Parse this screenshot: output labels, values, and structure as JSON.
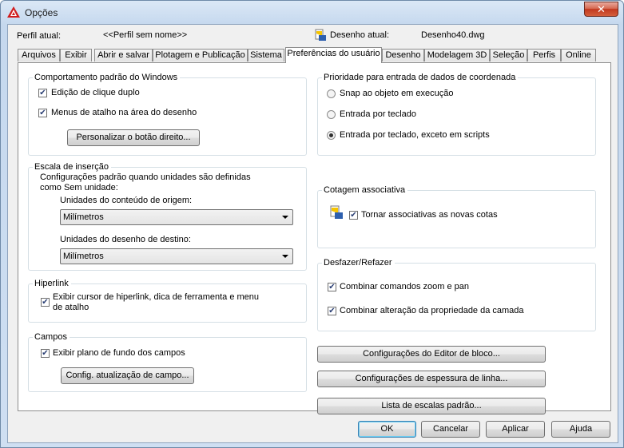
{
  "window": {
    "title": "Opções",
    "close_label": "✕"
  },
  "profile": {
    "label": "Perfil atual:",
    "value": "<<Perfil sem nome>>",
    "drawing_label": "Desenho atual:",
    "drawing_value": "Desenho40.dwg"
  },
  "tabs": [
    "Arquivos",
    "Exibir",
    "Abrir e salvar",
    "Plotagem e Publicação",
    "Sistema",
    "Preferências do usuário",
    "Desenho",
    "Modelagem 3D",
    "Seleção",
    "Perfis",
    "Online"
  ],
  "windows_behavior": {
    "title": "Comportamento padrão do Windows",
    "double_click": {
      "label": "Edição de clique duplo",
      "checked": true
    },
    "shortcut_menus": {
      "label": "Menus de atalho na área do desenho",
      "checked": true
    },
    "right_click_button": "Personalizar o botão direito..."
  },
  "insertion_scale": {
    "title": "Escala de inserção",
    "description_1": "Configurações padrão quando unidades são definidas",
    "description_2": "como Sem unidade:",
    "source_label": "Unidades do conteúdo de origem:",
    "source_value": "Milímetros",
    "target_label": "Unidades do desenho de destino:",
    "target_value": "Milímetros"
  },
  "hyperlink": {
    "title": "Hiperlink",
    "label_1": "Exibir cursor de hiperlink, dica de ferramenta e menu",
    "label_2": "de atalho",
    "checked": true
  },
  "fields": {
    "title": "Campos",
    "background": {
      "label": "Exibir plano de fundo dos campos",
      "checked": true
    },
    "update_button": "Config. atualização de campo..."
  },
  "coordinate_priority": {
    "title": "Prioridade para entrada de dados de coordenada",
    "options": [
      "Snap ao objeto em execução",
      "Entrada por teclado",
      "Entrada por teclado, exceto em scripts"
    ],
    "selected_index": 2
  },
  "associative_dim": {
    "title": "Cotagem associativa",
    "label": "Tornar associativas as novas cotas",
    "checked": true
  },
  "undo_redo": {
    "title": "Desfazer/Refazer",
    "zoom_pan": {
      "label": "Combinar comandos zoom e pan",
      "checked": true
    },
    "layer_props": {
      "label": "Combinar alteração da propriedade da camada",
      "checked": true
    }
  },
  "buttons": {
    "block_editor": "Configurações do Editor de bloco...",
    "lineweight": "Configurações de espessura de linha...",
    "scale_list": "Lista de escalas padrão...",
    "ok": "OK",
    "cancel": "Cancelar",
    "apply": "Aplicar",
    "help": "Ajuda"
  },
  "colors": {
    "accent": "#c2381f",
    "frame": "#c5d8ee",
    "panel": "#ffffff"
  }
}
